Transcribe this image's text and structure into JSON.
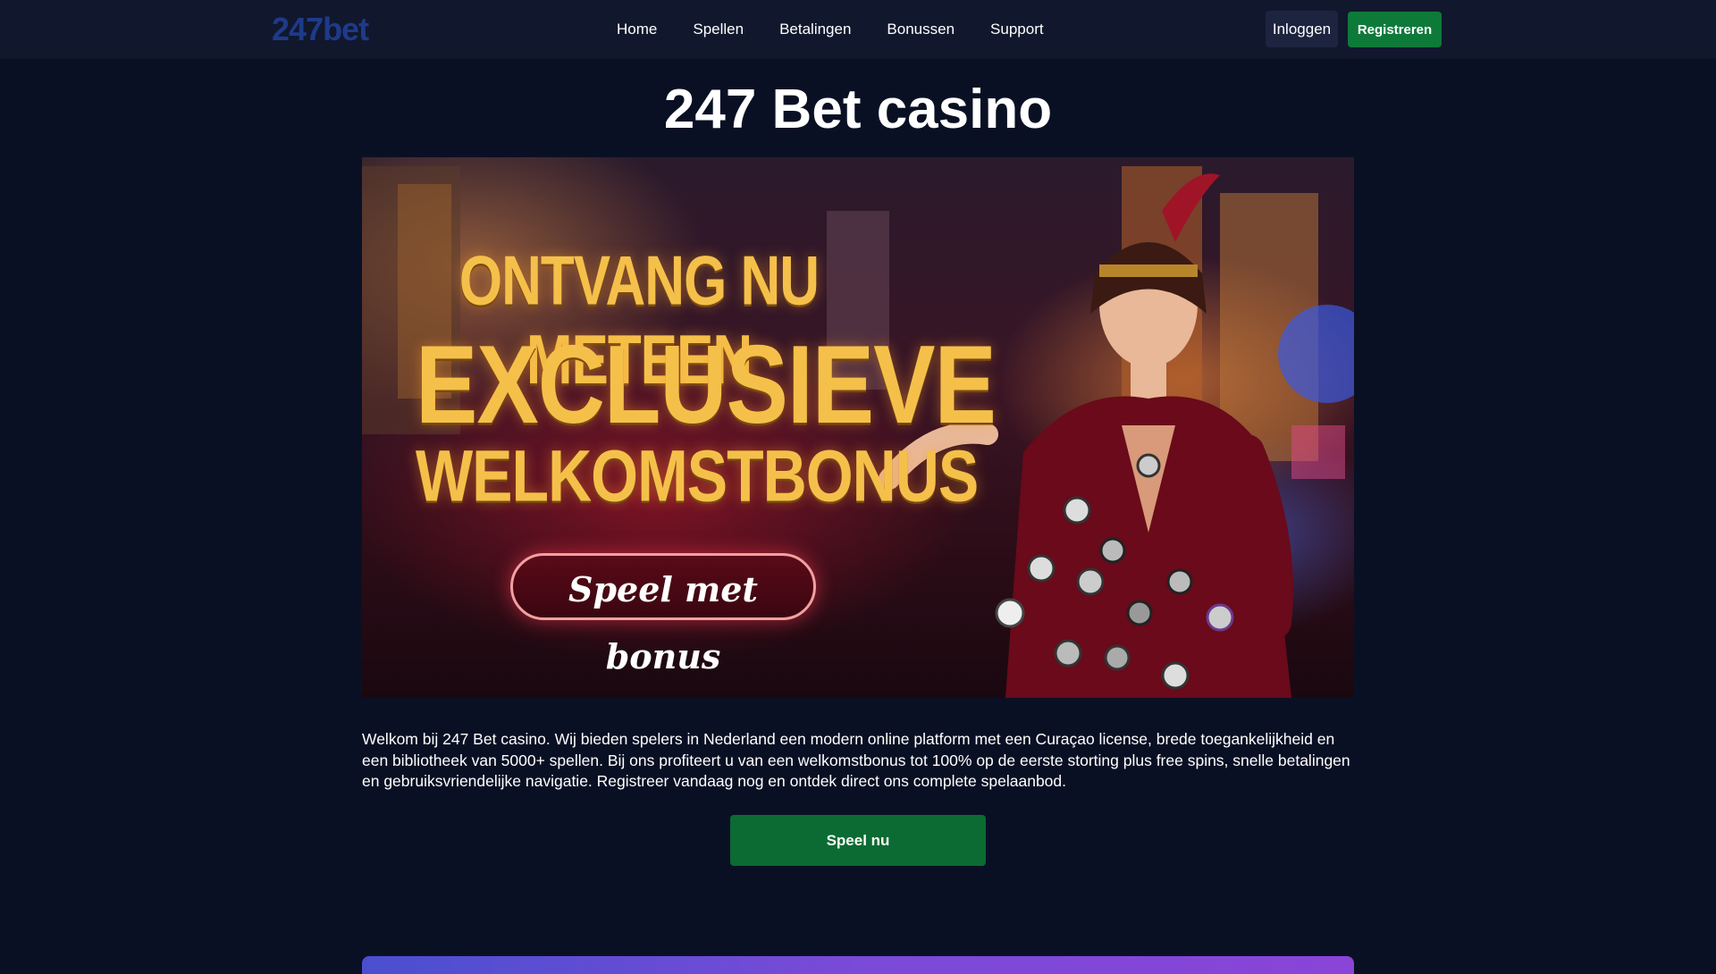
{
  "header": {
    "logo_text": "247bet",
    "nav": [
      "Home",
      "Spellen",
      "Betalingen",
      "Bonussen",
      "Support"
    ],
    "login_label": "Inloggen",
    "register_label": "Registreren"
  },
  "main": {
    "title": "247 Bet casino",
    "banner": {
      "line1": "ONTVANG NU METEEN",
      "line2": "EXCLUSIEVE",
      "line3": "WELKOMSTBONUS",
      "cta": "Speel met bonus"
    },
    "intro": "Welkom bij 247 Bet casino. Wij bieden spelers in Nederland een modern online platform met een Curaçao license, brede toegankelijkheid en een bibliotheek van 5000+ spellen. Bij ons profiteert u van een welkomstbonus tot 100% op de eerste storting plus free spins, snelle betalingen en gebruiksvriendelijke navigatie. Registreer vandaag nog en ontdek direct ons complete spelaanbod.",
    "play_label": "Speel nu"
  },
  "colors": {
    "background": "#0a1024",
    "header": "#11182d",
    "logo": "#1e3a8a",
    "primary_green": "#0b6b33",
    "login_bg": "#1d2440",
    "banner_gold": "#f5c04a"
  }
}
